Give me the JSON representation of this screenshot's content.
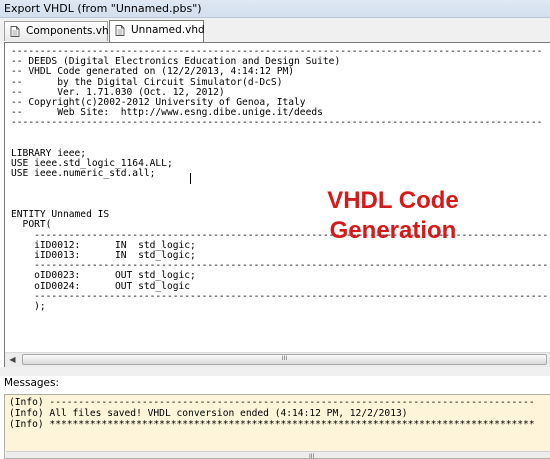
{
  "window": {
    "title": "Export VHDL (from \"Unnamed.pbs\")"
  },
  "tabs": [
    {
      "label": "Components.vhd",
      "icon": "document-icon",
      "active": false
    },
    {
      "label": "Unnamed.vhd",
      "icon": "document-icon",
      "active": true
    }
  ],
  "editor": {
    "code": "--------------------------------------------------------------------------------------------\n-- DEEDS (Digital Electronics Education and Design Suite)\n-- VHDL Code generated on (12/2/2013, 4:14:12 PM)\n--      by the Digital Circuit Simulator(d-DcS)\n--      Ver. 1.71.030 (Oct. 12, 2012)\n-- Copyright(c)2002-2012 University of Genoa, Italy\n--      Web Site:  http://www.esng.dibe.unige.it/deeds\n--------------------------------------------------------------------------------------------\n\n\nLIBRARY ieee;\nUSE ieee.std_logic_1164.ALL;\nUSE ieee.numeric_std.all;\n\n\n\nENTITY Unnamed IS\n  PORT(\n    -----------------------------------------------------------------------------------------\n    iID0012:      IN  std_logic;\n    iID0013:      IN  std_logic;\n    -----------------------------------------------------------------------------------------\n    oID0023:      OUT std_logic;\n    oID0024:      OUT std_logic\n    -----------------------------------------------------------------------------------------\n    );"
  },
  "overlay": {
    "line1": "VHDL Code",
    "line2": "Generation",
    "color": "#d41a1a"
  },
  "scrollbar": {
    "grip": "III"
  },
  "messages": {
    "label": "Messages:",
    "lines": [
      "(Info) ------------------------------------------------------------------------------------",
      "(Info) All files saved! VHDL conversion ended (4:14:12 PM, 12/2/2013)",
      "(Info) ************************************************************************************"
    ],
    "background": "#fdf4da"
  }
}
